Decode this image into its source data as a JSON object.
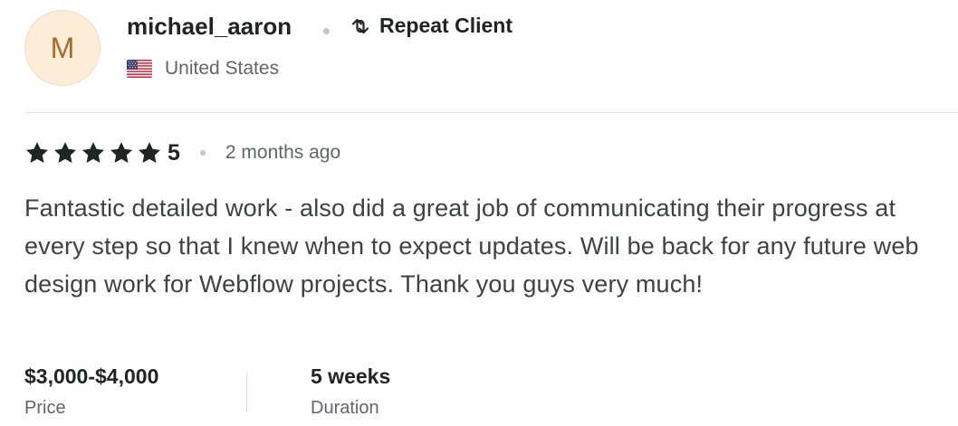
{
  "reviewer": {
    "initial": "M",
    "username": "michael_aaron",
    "badge_label": "Repeat Client",
    "badge_icon": "repeat-icon",
    "country": "United States",
    "flag_icon": "us-flag-icon"
  },
  "rating": {
    "stars": 5,
    "value": "5",
    "time_ago": "2 months ago",
    "star_color": "#222325"
  },
  "comment": "Fantastic detailed work - also did a great job of communicating their progress at every step so that I knew when to expect updates. Will be back for any future web design work for Webflow projects. Thank you guys very much!",
  "details": {
    "price_value": "$3,000-$4,000",
    "price_label": "Price",
    "duration_value": "5 weeks",
    "duration_label": "Duration"
  },
  "colors": {
    "avatar_bg": "#fcecd8",
    "avatar_text": "#a66a2c",
    "muted_text": "#62646a"
  }
}
